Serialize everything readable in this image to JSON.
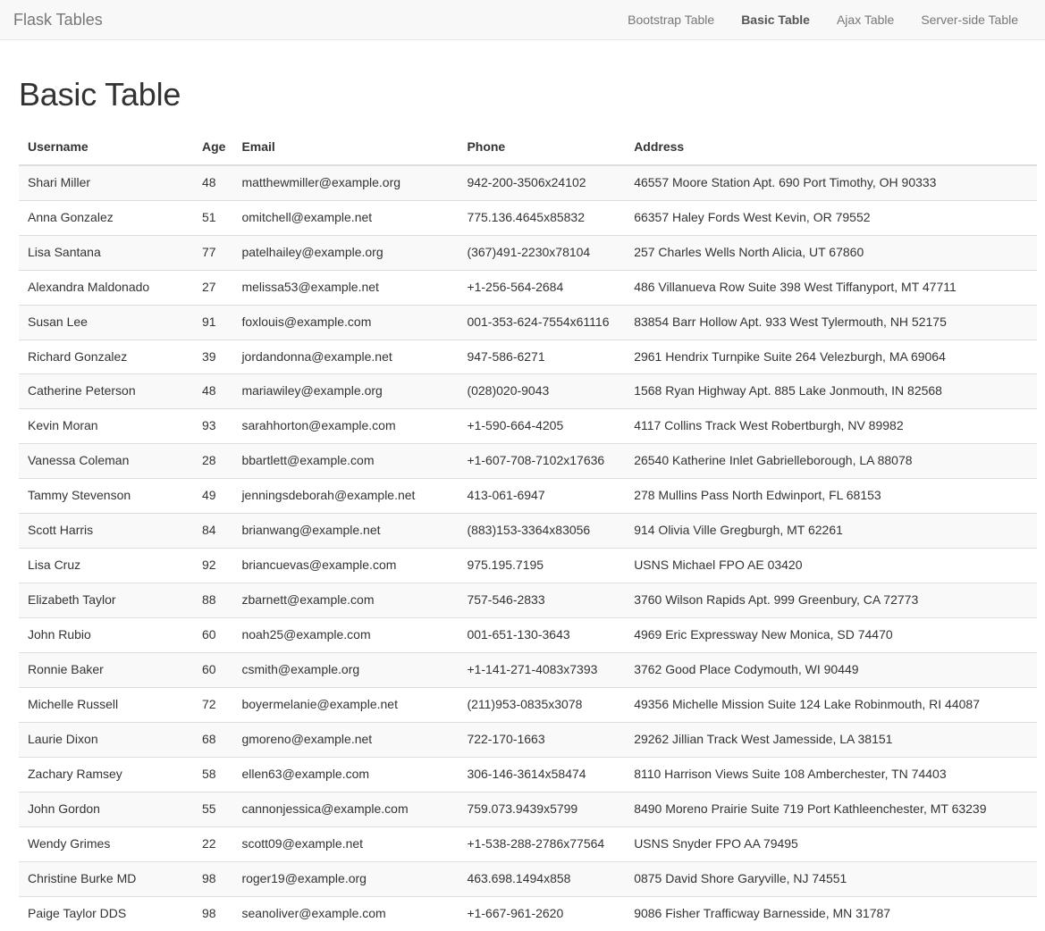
{
  "navbar": {
    "brand": "Flask Tables",
    "links": [
      {
        "label": "Bootstrap Table",
        "active": false
      },
      {
        "label": "Basic Table",
        "active": true
      },
      {
        "label": "Ajax Table",
        "active": false
      },
      {
        "label": "Server-side Table",
        "active": false
      }
    ]
  },
  "page": {
    "title": "Basic Table"
  },
  "table": {
    "columns": [
      "Username",
      "Age",
      "Email",
      "Phone",
      "Address"
    ],
    "rows": [
      {
        "username": "Shari Miller",
        "age": "48",
        "email": "matthewmiller@example.org",
        "phone": "942-200-3506x24102",
        "address": "46557 Moore Station Apt. 690 Port Timothy, OH 90333"
      },
      {
        "username": "Anna Gonzalez",
        "age": "51",
        "email": "omitchell@example.net",
        "phone": "775.136.4645x85832",
        "address": "66357 Haley Fords West Kevin, OR 79552"
      },
      {
        "username": "Lisa Santana",
        "age": "77",
        "email": "patelhailey@example.org",
        "phone": "(367)491-2230x78104",
        "address": "257 Charles Wells North Alicia, UT 67860"
      },
      {
        "username": "Alexandra Maldonado",
        "age": "27",
        "email": "melissa53@example.net",
        "phone": "+1-256-564-2684",
        "address": "486 Villanueva Row Suite 398 West Tiffanyport, MT 47711"
      },
      {
        "username": "Susan Lee",
        "age": "91",
        "email": "foxlouis@example.com",
        "phone": "001-353-624-7554x61116",
        "address": "83854 Barr Hollow Apt. 933 West Tylermouth, NH 52175"
      },
      {
        "username": "Richard Gonzalez",
        "age": "39",
        "email": "jordandonna@example.net",
        "phone": "947-586-6271",
        "address": "2961 Hendrix Turnpike Suite 264 Velezburgh, MA 69064"
      },
      {
        "username": "Catherine Peterson",
        "age": "48",
        "email": "mariawiley@example.org",
        "phone": "(028)020-9043",
        "address": "1568 Ryan Highway Apt. 885 Lake Jonmouth, IN 82568"
      },
      {
        "username": "Kevin Moran",
        "age": "93",
        "email": "sarahhorton@example.com",
        "phone": "+1-590-664-4205",
        "address": "4117 Collins Track West Robertburgh, NV 89982"
      },
      {
        "username": "Vanessa Coleman",
        "age": "28",
        "email": "bbartlett@example.com",
        "phone": "+1-607-708-7102x17636",
        "address": "26540 Katherine Inlet Gabrielleborough, LA 88078"
      },
      {
        "username": "Tammy Stevenson",
        "age": "49",
        "email": "jenningsdeborah@example.net",
        "phone": "413-061-6947",
        "address": "278 Mullins Pass North Edwinport, FL 68153"
      },
      {
        "username": "Scott Harris",
        "age": "84",
        "email": "brianwang@example.net",
        "phone": "(883)153-3364x83056",
        "address": "914 Olivia Ville Gregburgh, MT 62261"
      },
      {
        "username": "Lisa Cruz",
        "age": "92",
        "email": "briancuevas@example.com",
        "phone": "975.195.7195",
        "address": "USNS Michael FPO AE 03420"
      },
      {
        "username": "Elizabeth Taylor",
        "age": "88",
        "email": "zbarnett@example.com",
        "phone": "757-546-2833",
        "address": "3760 Wilson Rapids Apt. 999 Greenbury, CA 72773"
      },
      {
        "username": "John Rubio",
        "age": "60",
        "email": "noah25@example.com",
        "phone": "001-651-130-3643",
        "address": "4969 Eric Expressway New Monica, SD 74470"
      },
      {
        "username": "Ronnie Baker",
        "age": "60",
        "email": "csmith@example.org",
        "phone": "+1-141-271-4083x7393",
        "address": "3762 Good Place Codymouth, WI 90449"
      },
      {
        "username": "Michelle Russell",
        "age": "72",
        "email": "boyermelanie@example.net",
        "phone": "(211)953-0835x3078",
        "address": "49356 Michelle Mission Suite 124 Lake Robinmouth, RI 44087"
      },
      {
        "username": "Laurie Dixon",
        "age": "68",
        "email": "gmoreno@example.net",
        "phone": "722-170-1663",
        "address": "29262 Jillian Track West Jamesside, LA 38151"
      },
      {
        "username": "Zachary Ramsey",
        "age": "58",
        "email": "ellen63@example.com",
        "phone": "306-146-3614x58474",
        "address": "8110 Harrison Views Suite 108 Amberchester, TN 74403"
      },
      {
        "username": "John Gordon",
        "age": "55",
        "email": "cannonjessica@example.com",
        "phone": "759.073.9439x5799",
        "address": "8490 Moreno Prairie Suite 719 Port Kathleenchester, MT 63239"
      },
      {
        "username": "Wendy Grimes",
        "age": "22",
        "email": "scott09@example.net",
        "phone": "+1-538-288-2786x77564",
        "address": "USNS Snyder FPO AA 79495"
      },
      {
        "username": "Christine Burke MD",
        "age": "98",
        "email": "roger19@example.org",
        "phone": "463.698.1494x858",
        "address": "0875 David Shore Garyville, NJ 74551"
      },
      {
        "username": "Paige Taylor DDS",
        "age": "98",
        "email": "seanoliver@example.com",
        "phone": "+1-667-961-2620",
        "address": "9086 Fisher Trafficway Barnesside, MN 31787"
      }
    ]
  },
  "colors": {
    "navbar_bg": "#f8f8f8",
    "navbar_border": "#e7e7e7",
    "muted_text": "#777777",
    "active_text": "#555555",
    "body_text": "#333333",
    "stripe_bg": "#f9f9f9",
    "row_border": "#dddddd"
  }
}
